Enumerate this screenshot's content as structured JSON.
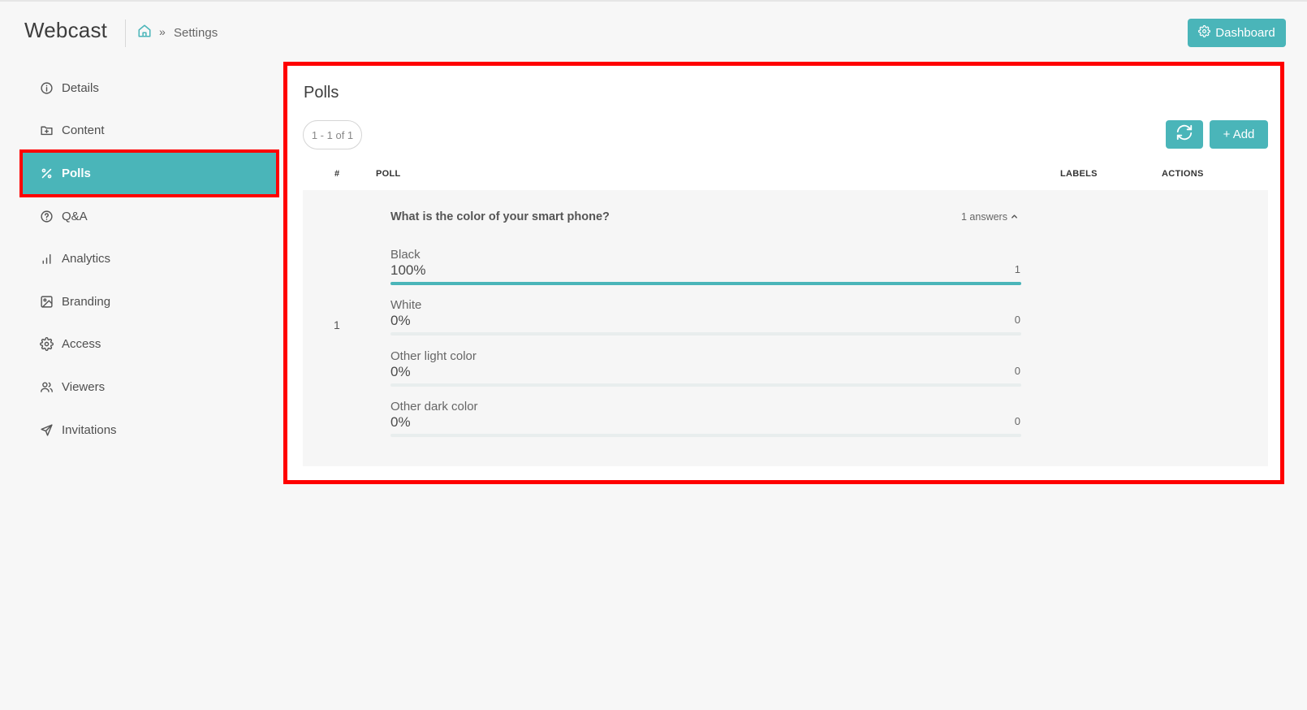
{
  "header": {
    "app_title": "Webcast",
    "breadcrumb_separator": "»",
    "breadcrumb_current": "Settings",
    "dashboard_label": "Dashboard"
  },
  "sidebar": {
    "items": [
      {
        "label": "Details",
        "icon": "info-circle-icon"
      },
      {
        "label": "Content",
        "icon": "folder-plus-icon"
      },
      {
        "label": "Polls",
        "icon": "percent-icon",
        "active": true
      },
      {
        "label": "Q&A",
        "icon": "question-circle-icon"
      },
      {
        "label": "Analytics",
        "icon": "bar-chart-icon"
      },
      {
        "label": "Branding",
        "icon": "image-icon"
      },
      {
        "label": "Access",
        "icon": "gear-icon"
      },
      {
        "label": "Viewers",
        "icon": "users-icon"
      },
      {
        "label": "Invitations",
        "icon": "send-icon"
      }
    ]
  },
  "polls": {
    "title": "Polls",
    "pager": "1 - 1 of 1",
    "add_label": "+ Add",
    "columns": {
      "num": "#",
      "poll": "POLL",
      "labels": "LABELS",
      "actions": "ACTIONS"
    },
    "rows": [
      {
        "num": "1",
        "question": "What is the color of your smart phone?",
        "answers_label": "1 answers",
        "options": [
          {
            "label": "Black",
            "percent": "100%",
            "count": "1",
            "fraction": 1.0
          },
          {
            "label": "White",
            "percent": "0%",
            "count": "0",
            "fraction": 0
          },
          {
            "label": "Other light color",
            "percent": "0%",
            "count": "0",
            "fraction": 0
          },
          {
            "label": "Other dark color",
            "percent": "0%",
            "count": "0",
            "fraction": 0
          }
        ]
      }
    ]
  },
  "colors": {
    "accent": "#4ab5b9",
    "highlight": "#ff0000"
  }
}
